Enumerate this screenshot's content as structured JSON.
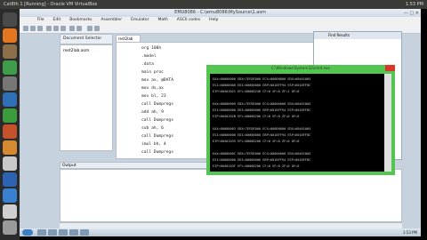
{
  "host": {
    "title": "Cat8th 1 [Running] - Oracle VM VirtualBox",
    "clock": "1:53 PM"
  },
  "launcher": {
    "icons": [
      {
        "name": "dash-icon",
        "color": "#4a4a4a"
      },
      {
        "name": "firefox-icon",
        "color": "#e3761f"
      },
      {
        "name": "files-icon",
        "color": "#8a6f4a"
      },
      {
        "name": "chrome-icon",
        "color": "#3f9d4a"
      },
      {
        "name": "settings-icon",
        "color": "#777777"
      },
      {
        "name": "writer-icon",
        "color": "#2f6fb5"
      },
      {
        "name": "calc-icon",
        "color": "#3c9b3c"
      },
      {
        "name": "impress-icon",
        "color": "#c6522b"
      },
      {
        "name": "software-icon",
        "color": "#d58a32"
      },
      {
        "name": "amazon-icon",
        "color": "#c9c9c9"
      },
      {
        "name": "virtualbox-icon",
        "color": "#2d64b2"
      },
      {
        "name": "writer2-icon",
        "color": "#3a80d0"
      },
      {
        "name": "text-editor-icon",
        "color": "#cfcfcf"
      },
      {
        "name": "trash-icon",
        "color": "#9a9a9a"
      }
    ]
  },
  "guest": {
    "title": "EMU8086 - C:\\emu8086\\MySource\\1.asm",
    "menu": [
      "File",
      "Edit",
      "Bookmarks",
      "Assembler",
      "Emulator",
      "Math",
      "ASCII codes",
      "Help"
    ],
    "doc_selector_title": "Document Selector",
    "doc_item": "rest2lab.asm",
    "editor_tab": "rest2lab",
    "editor_lines": [
      "org 100h",
      ".model",
      ".data",
      "main proc",
      "mov ax, @DATA",
      "mov ds,ax",
      "mov bl, 23",
      "call Dumpregs",
      "add ah, 9",
      "call Dumpregs",
      "sub ah, 6",
      "call Dumpregs",
      "imul bh, 4",
      "call Dumpregs"
    ],
    "right_pane_title": "Find Results",
    "log_label": "Output"
  },
  "cmd": {
    "title": "C:\\Windows\\System32\\cmd.exe",
    "lines": [
      "EAX=00000000  EBX=7EFDE000  ECX=00000000  EDX=00401005",
      "ESI=00000000  EDI=00000000  EBP=0018FF94  ESP=0018FF8C",
      "EIP=00401021  EFL=00000246  CF=0  SF=0  ZF=1  OF=0",
      "",
      "EAX=00000009  EBX=7EFDE000  ECX=00000000  EDX=00401005",
      "ESI=00000000  EDI=00000000  EBP=0018FF94  ESP=0018FF8C",
      "EIP=0040102B  EFL=00000206  CF=0  SF=0  ZF=0  OF=0",
      "",
      "EAX=00000003  EBX=7EFDE000  ECX=00000000  EDX=00401005",
      "ESI=00000000  EDI=00000000  EBP=0018FF94  ESP=0018FF8C",
      "EIP=00401035  EFL=00000206  CF=0  SF=0  ZF=0  OF=0",
      "",
      "EAX=0000000C  EBX=7EFDE000  ECX=00000000  EDX=00401005",
      "ESI=00000000  EDI=00000000  EBP=0018FF94  ESP=0018FF8C",
      "EIP=0040103F  EFL=00000206  CF=0  SF=0  ZF=0  OF=0"
    ]
  },
  "taskbar": {
    "clock": "1:53 PM"
  }
}
